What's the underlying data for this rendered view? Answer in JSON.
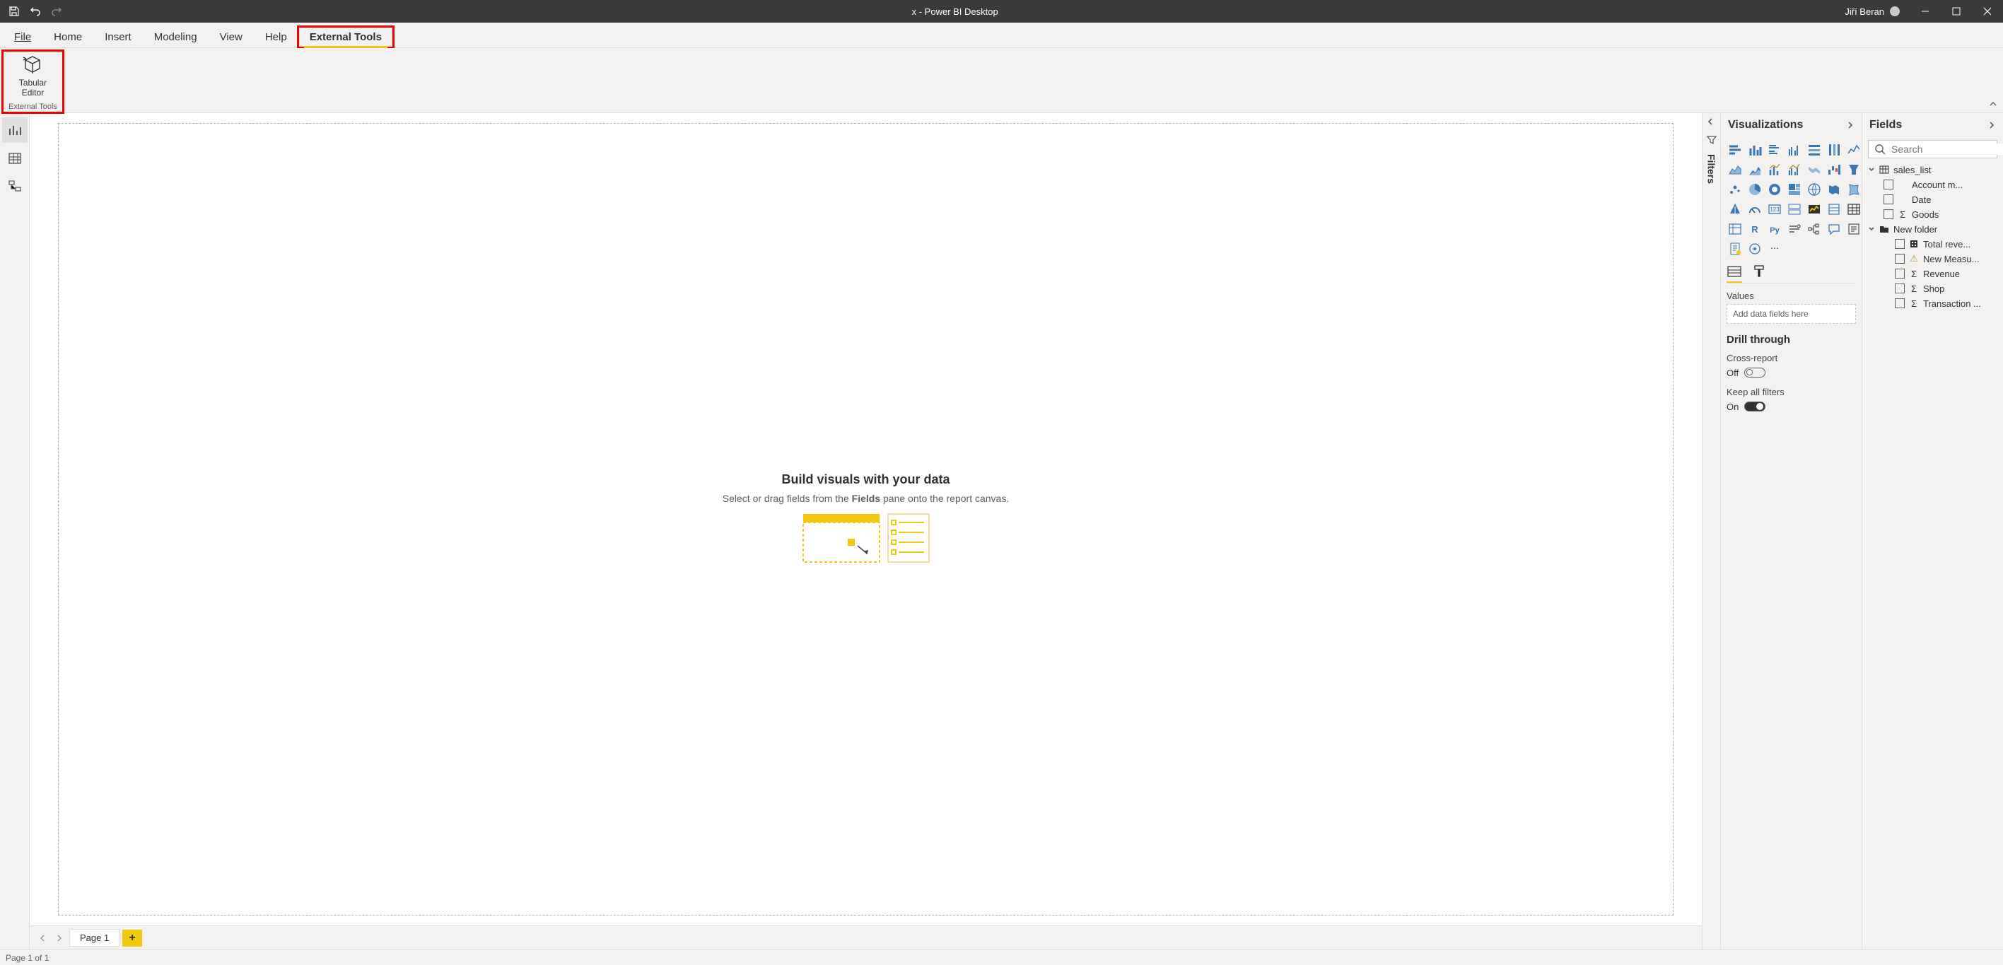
{
  "titlebar": {
    "title": "x - Power BI Desktop",
    "user": "Jiří Beran"
  },
  "ribbon": {
    "tabs": [
      "File",
      "Home",
      "Insert",
      "Modeling",
      "View",
      "Help",
      "External Tools"
    ],
    "active_index": 6,
    "group_label": "External Tools",
    "tabular_btn_line1": "Tabular",
    "tabular_btn_line2": "Editor"
  },
  "canvas": {
    "heading": "Build visuals with your data",
    "sub_prefix": "Select or drag fields from the ",
    "sub_bold": "Fields",
    "sub_suffix": " pane onto the report canvas."
  },
  "page_tabs": {
    "page1": "Page 1"
  },
  "filters_label": "Filters",
  "viz_pane": {
    "title": "Visualizations",
    "values_label": "Values",
    "values_placeholder": "Add data fields here",
    "drill_title": "Drill through",
    "cross_label": "Cross-report",
    "cross_state": "Off",
    "keep_label": "Keep all filters",
    "keep_state": "On"
  },
  "fields_pane": {
    "title": "Fields",
    "search_placeholder": "Search",
    "table": "sales_list",
    "folder": "New folder",
    "items_top": [
      "Account m...",
      "Date",
      "Goods"
    ],
    "items_folder": [
      "Total reve...",
      "New Measu...",
      "Revenue",
      "Shop",
      "Transaction ..."
    ]
  },
  "statusbar": {
    "text": "Page 1 of 1"
  }
}
